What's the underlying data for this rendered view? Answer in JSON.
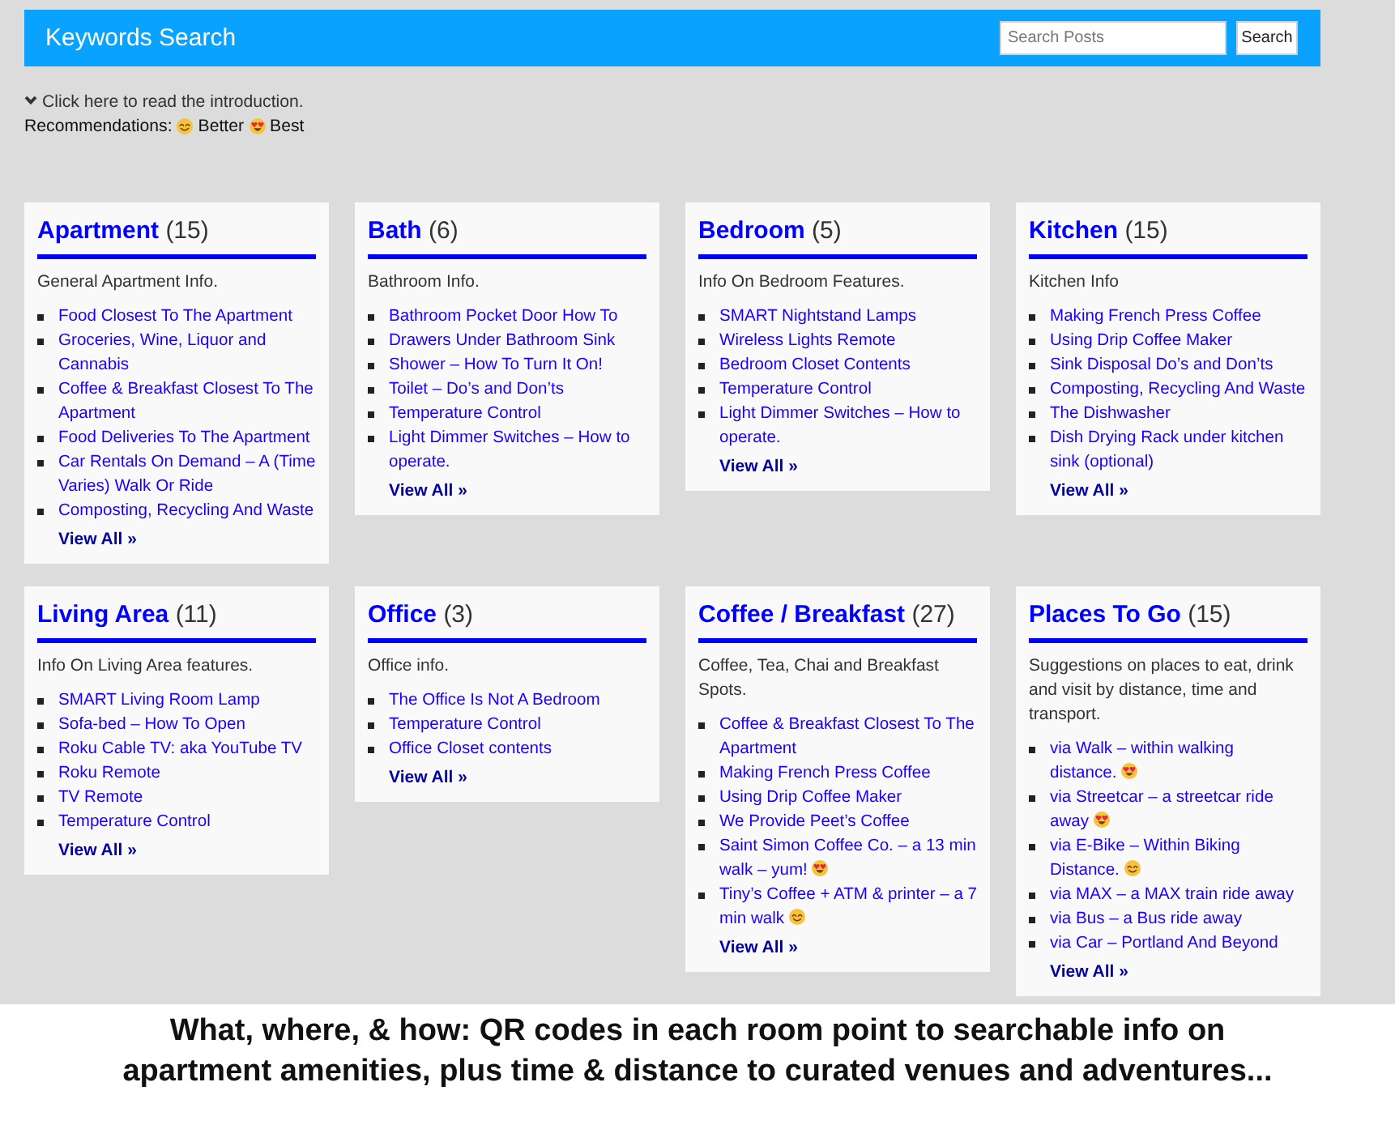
{
  "header": {
    "title": "Keywords Search",
    "search": {
      "placeholder": "Search Posts"
    },
    "search_button": "Search"
  },
  "intro_link": "Click here to read the introduction.",
  "recommendations": {
    "label": "Recommendations:",
    "levels": [
      {
        "kind": "better",
        "label": "Better"
      },
      {
        "kind": "best",
        "label": "Best"
      }
    ]
  },
  "categories": [
    {
      "name": "Apartment",
      "count": "(15)",
      "description": "General Apartment Info.",
      "links": [
        {
          "kind": "plain",
          "label": "Food Closest To The Apartment"
        },
        {
          "kind": "plain",
          "label": "Groceries, Wine, Liquor and Cannabis"
        },
        {
          "kind": "plain",
          "label": "Coffee & Breakfast Closest To The Apartment"
        },
        {
          "kind": "plain",
          "label": "Food Deliveries To The Apartment"
        },
        {
          "kind": "plain",
          "label": "Car Rentals On Demand – A (Time Varies) Walk Or Ride"
        },
        {
          "kind": "plain",
          "label": "Composting, Recycling And Waste"
        }
      ],
      "view_all": "View All »"
    },
    {
      "name": "Bath",
      "count": "(6)",
      "description": "Bathroom Info.",
      "links": [
        {
          "kind": "plain",
          "label": "Bathroom Pocket Door How To"
        },
        {
          "kind": "plain",
          "label": "Drawers Under Bathroom Sink"
        },
        {
          "kind": "plain",
          "label": "Shower – How To Turn It On!"
        },
        {
          "kind": "plain",
          "label": "Toilet – Do’s and Don’ts"
        },
        {
          "kind": "plain",
          "label": "Temperature Control"
        },
        {
          "kind": "plain",
          "label": "Light Dimmer Switches – How to operate."
        }
      ],
      "view_all": "View All »"
    },
    {
      "name": "Bedroom",
      "count": "(5)",
      "description": "Info On Bedroom Features.",
      "links": [
        {
          "kind": "plain",
          "label": "SMART Nightstand Lamps"
        },
        {
          "kind": "plain",
          "label": "Wireless Lights Remote"
        },
        {
          "kind": "plain",
          "label": "Bedroom Closet Contents"
        },
        {
          "kind": "plain",
          "label": "Temperature Control"
        },
        {
          "kind": "plain",
          "label": "Light Dimmer Switches – How to operate."
        }
      ],
      "view_all": "View All »"
    },
    {
      "name": "Kitchen",
      "count": "(15)",
      "description": "Kitchen Info",
      "links": [
        {
          "kind": "plain",
          "label": "Making French Press Coffee"
        },
        {
          "kind": "plain",
          "label": "Using Drip Coffee Maker"
        },
        {
          "kind": "plain",
          "label": "Sink Disposal Do’s and Don’ts"
        },
        {
          "kind": "plain",
          "label": "Composting, Recycling And Waste"
        },
        {
          "kind": "plain",
          "label": "The Dishwasher"
        },
        {
          "kind": "plain",
          "label": "Dish Drying Rack under kitchen sink (optional)"
        }
      ],
      "view_all": "View All »"
    },
    {
      "name": "Living Area",
      "count": "(11)",
      "description": "Info On Living Area features.",
      "links": [
        {
          "kind": "plain",
          "label": "SMART Living Room Lamp"
        },
        {
          "kind": "plain",
          "label": "Sofa-bed – How To Open"
        },
        {
          "kind": "plain",
          "label": "Roku Cable TV: aka YouTube TV"
        },
        {
          "kind": "plain",
          "label": "Roku Remote"
        },
        {
          "kind": "plain",
          "label": "TV Remote"
        },
        {
          "kind": "plain",
          "label": "Temperature Control"
        }
      ],
      "view_all": "View All »"
    },
    {
      "name": "Office",
      "count": "(3)",
      "description": "Office info.",
      "links": [
        {
          "kind": "plain",
          "label": "The Office Is Not A Bedroom"
        },
        {
          "kind": "plain",
          "label": "Temperature Control"
        },
        {
          "kind": "plain",
          "label": "Office Closet contents"
        }
      ],
      "view_all": "View All »"
    },
    {
      "name": "Coffee / Breakfast",
      "count": "(27)",
      "description": "Coffee, Tea, Chai and Breakfast Spots.",
      "links": [
        {
          "kind": "plain",
          "label": "Coffee & Breakfast Closest To The Apartment"
        },
        {
          "kind": "plain",
          "label": "Making French Press Coffee"
        },
        {
          "kind": "plain",
          "label": "Using Drip Coffee Maker"
        },
        {
          "kind": "plain",
          "label": "We Provide Peet’s Coffee"
        },
        {
          "kind": "best",
          "label": "Saint Simon Coffee Co. – a 13 min walk – yum!"
        },
        {
          "kind": "better",
          "label": "Tiny’s Coffee + ATM & printer – a 7 min walk"
        }
      ],
      "view_all": "View All »"
    },
    {
      "name": "Places To Go",
      "count": "(15)",
      "description": "Suggestions on places to eat, drink and visit by distance, time and transport.",
      "links": [
        {
          "kind": "best",
          "label": "via Walk – within walking distance."
        },
        {
          "kind": "best",
          "label": "via Streetcar – a streetcar ride away"
        },
        {
          "kind": "better",
          "label": "via E-Bike – Within Biking Distance."
        },
        {
          "kind": "plain",
          "label": "via MAX – a MAX train ride away"
        },
        {
          "kind": "plain",
          "label": "via Bus – a Bus ride away"
        },
        {
          "kind": "plain",
          "label": "via Car – Portland And Beyond"
        }
      ],
      "view_all": "View All »"
    }
  ],
  "caption": {
    "lines": [
      "What, where, & how: QR codes in each room point to searchable info on",
      "apartment amenities, plus time & distance to curated venues and adventures..."
    ]
  }
}
